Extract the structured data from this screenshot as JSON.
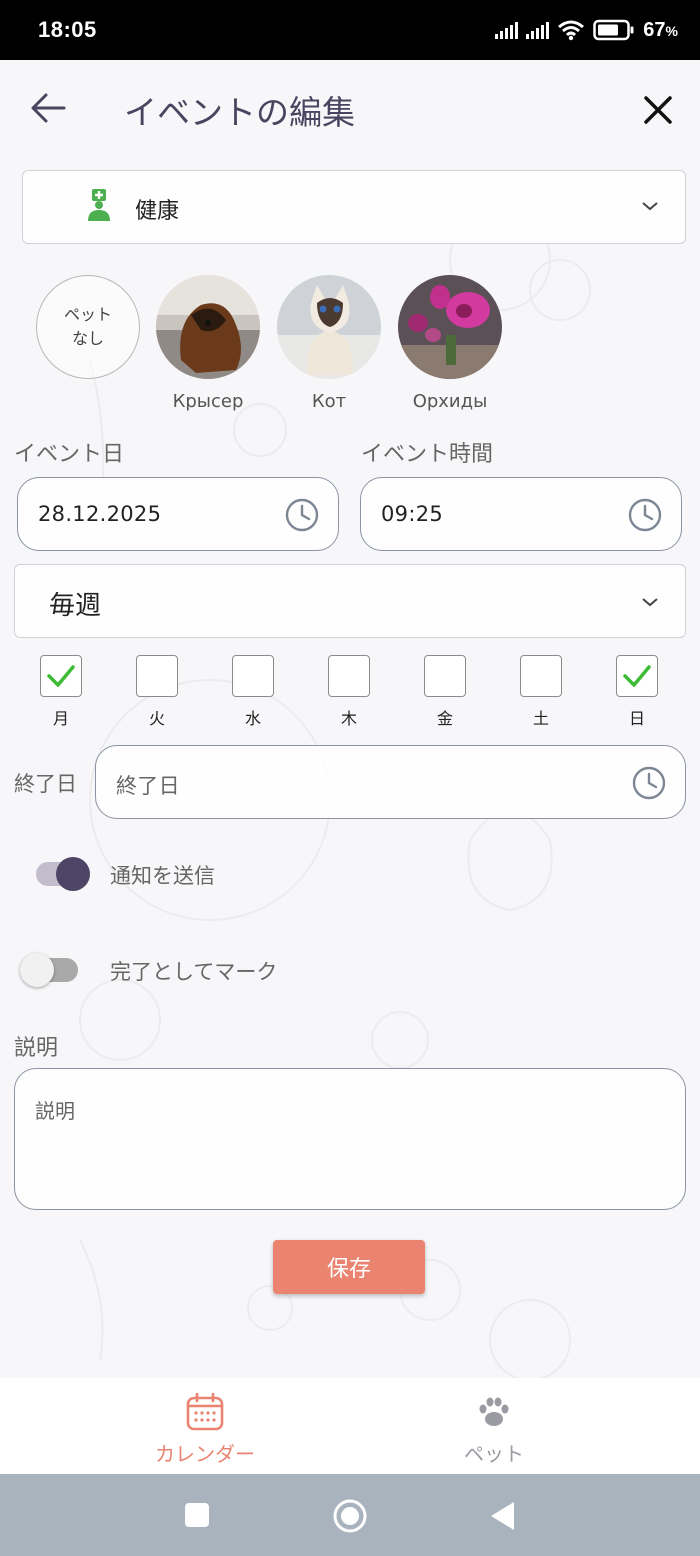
{
  "status_bar": {
    "time": "18:05",
    "battery": "67",
    "battery_unit": "%"
  },
  "header": {
    "title": "イベントの編集"
  },
  "category": {
    "label": "健康"
  },
  "pets": {
    "none_label_line1": "ペット",
    "none_label_line2": "なし",
    "items": [
      {
        "name": "Крысер"
      },
      {
        "name": "Кот"
      },
      {
        "name": "Орхиды"
      }
    ]
  },
  "event_date": {
    "label": "イベント日",
    "value": "28.12.2025"
  },
  "event_time": {
    "label": "イベント時間",
    "value": "09:25"
  },
  "repeat": {
    "value": "毎週"
  },
  "weekdays": [
    {
      "label": "月",
      "checked": true
    },
    {
      "label": "火",
      "checked": false
    },
    {
      "label": "水",
      "checked": false
    },
    {
      "label": "木",
      "checked": false
    },
    {
      "label": "金",
      "checked": false
    },
    {
      "label": "土",
      "checked": false
    },
    {
      "label": "日",
      "checked": true
    }
  ],
  "end_date": {
    "label": "終了日",
    "placeholder": "終了日"
  },
  "notify": {
    "label": "通知を送信",
    "on": true
  },
  "mark_done": {
    "label": "完了としてマーク",
    "on": false
  },
  "description": {
    "label": "説明",
    "placeholder": "説明"
  },
  "save_label": "保存",
  "nav": {
    "calendar": "カレンダー",
    "pets": "ペット"
  },
  "colors": {
    "accent": "#ea8471",
    "toggle_on": "#4d4466",
    "title": "#4a4460",
    "category_icon": "#4caf50",
    "check": "#3dbb35"
  }
}
